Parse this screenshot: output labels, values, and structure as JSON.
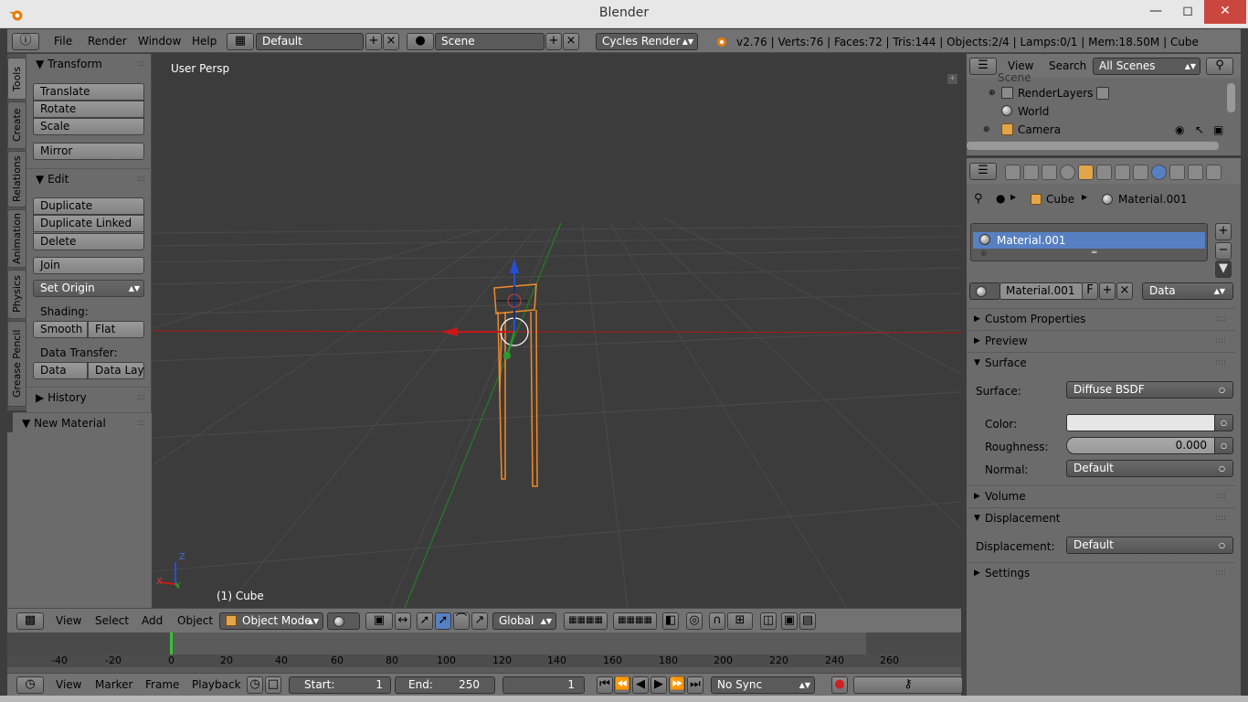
{
  "window": {
    "title": "Blender"
  },
  "info_header": {
    "menus": [
      "File",
      "Render",
      "Window",
      "Help"
    ],
    "screen_layout": "Default",
    "scene": "Scene",
    "engine": "Cycles Render",
    "stats": "v2.76 | Verts:76 | Faces:72 | Tris:144 | Objects:2/4 | Lamps:0/1 | Mem:18.50M | Cube"
  },
  "tool_tabs": [
    "Tools",
    "Create",
    "Relations",
    "Animation",
    "Physics",
    "Grease Pencil"
  ],
  "tool_shelf": {
    "transform": {
      "title": "Transform",
      "buttons": [
        "Translate",
        "Rotate",
        "Scale",
        "Mirror"
      ]
    },
    "edit": {
      "title": "Edit",
      "buttons": [
        "Duplicate",
        "Duplicate Linked",
        "Delete",
        "Join"
      ],
      "set_origin": "Set Origin",
      "shading_label": "Shading:",
      "shading": [
        "Smooth",
        "Flat"
      ],
      "data_transfer_label": "Data Transfer:",
      "data_transfer": [
        "Data",
        "Data Layo"
      ]
    },
    "history": "History",
    "new_material": "New Material"
  },
  "viewport": {
    "view_name": "User Persp",
    "object_label": "(1) Cube",
    "axis_x": "X",
    "axis_y": "Y",
    "axis_z": "Z"
  },
  "viewport_header": {
    "menus": [
      "View",
      "Select",
      "Add",
      "Object"
    ],
    "mode": "Object Mode",
    "orientation": "Global"
  },
  "timeline": {
    "ticks": [
      "-40",
      "-20",
      "0",
      "20",
      "40",
      "60",
      "80",
      "100",
      "120",
      "140",
      "160",
      "180",
      "200",
      "220",
      "240",
      "260"
    ],
    "menus": [
      "View",
      "Marker",
      "Frame",
      "Playback"
    ],
    "start_label": "Start:",
    "start_value": "1",
    "end_label": "End:",
    "end_value": "250",
    "current_frame": "1",
    "sync": "No Sync"
  },
  "outliner": {
    "menus": [
      "View",
      "Search"
    ],
    "filter": "All Scenes",
    "rows": [
      "Scene",
      "RenderLayers",
      "World",
      "Camera"
    ]
  },
  "properties": {
    "breadcrumb_object": "Cube",
    "breadcrumb_material": "Material.001",
    "slot_name": "Material.001",
    "material_name": "Material.001",
    "fake_user": "F",
    "link": "Data",
    "sections": {
      "custom": "Custom Properties",
      "preview": "Preview",
      "surface": "Surface",
      "volume": "Volume",
      "displacement": "Displacement",
      "settings": "Settings"
    },
    "surface": {
      "surface_label": "Surface:",
      "surface_value": "Diffuse BSDF",
      "color_label": "Color:",
      "roughness_label": "Roughness:",
      "roughness_value": "0.000",
      "normal_label": "Normal:",
      "normal_value": "Default"
    },
    "displacement": {
      "label": "Displacement:",
      "value": "Default"
    }
  },
  "colors": {
    "accent": "#5680c2",
    "close": "#c9473e",
    "x_axis": "#c8181a",
    "y_axis": "#2a9a2a",
    "z_axis": "#2450d8",
    "selection": "#f08a28"
  }
}
